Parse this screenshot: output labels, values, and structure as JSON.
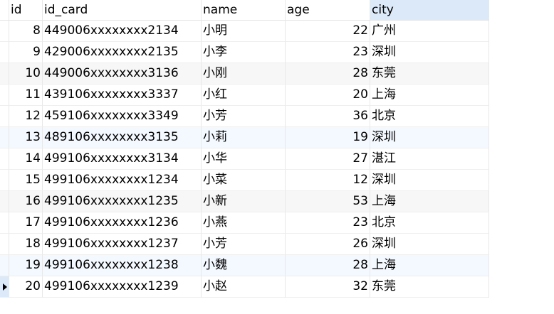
{
  "columns": [
    "id",
    "id_card",
    "name",
    "age",
    "city"
  ],
  "rows": [
    [
      "8",
      "449006xxxxxxxx2134",
      "小明",
      "22",
      "广州"
    ],
    [
      "9",
      "429006xxxxxxxx2135",
      "小李",
      "23",
      "深圳"
    ],
    [
      "10",
      "449006xxxxxxxx3136",
      "小刚",
      "28",
      "东莞"
    ],
    [
      "11",
      "439106xxxxxxxx3337",
      "小红",
      "20",
      "上海"
    ],
    [
      "12",
      "459106xxxxxxxx3349",
      "小芳",
      "36",
      "北京"
    ],
    [
      "13",
      "489106xxxxxxxx3135",
      "小莉",
      "19",
      "深圳"
    ],
    [
      "14",
      "499106xxxxxxxx3134",
      "小华",
      "27",
      "湛江"
    ],
    [
      "15",
      "499106xxxxxxxx1234",
      "小菜",
      "12",
      "深圳"
    ],
    [
      "16",
      "499106xxxxxxxx1235",
      "小新",
      "53",
      "上海"
    ],
    [
      "17",
      "499106xxxxxxxx1236",
      "小燕",
      "23",
      "北京"
    ],
    [
      "18",
      "499106xxxxxxxx1237",
      "小芳",
      "26",
      "深圳"
    ],
    [
      "19",
      "499106xxxxxxxx1238",
      "小魏",
      "28",
      "上海"
    ],
    [
      "20",
      "499106xxxxxxxx1239",
      "小赵",
      "32",
      "东莞"
    ]
  ],
  "selected_column": "city",
  "current_row": 12
}
